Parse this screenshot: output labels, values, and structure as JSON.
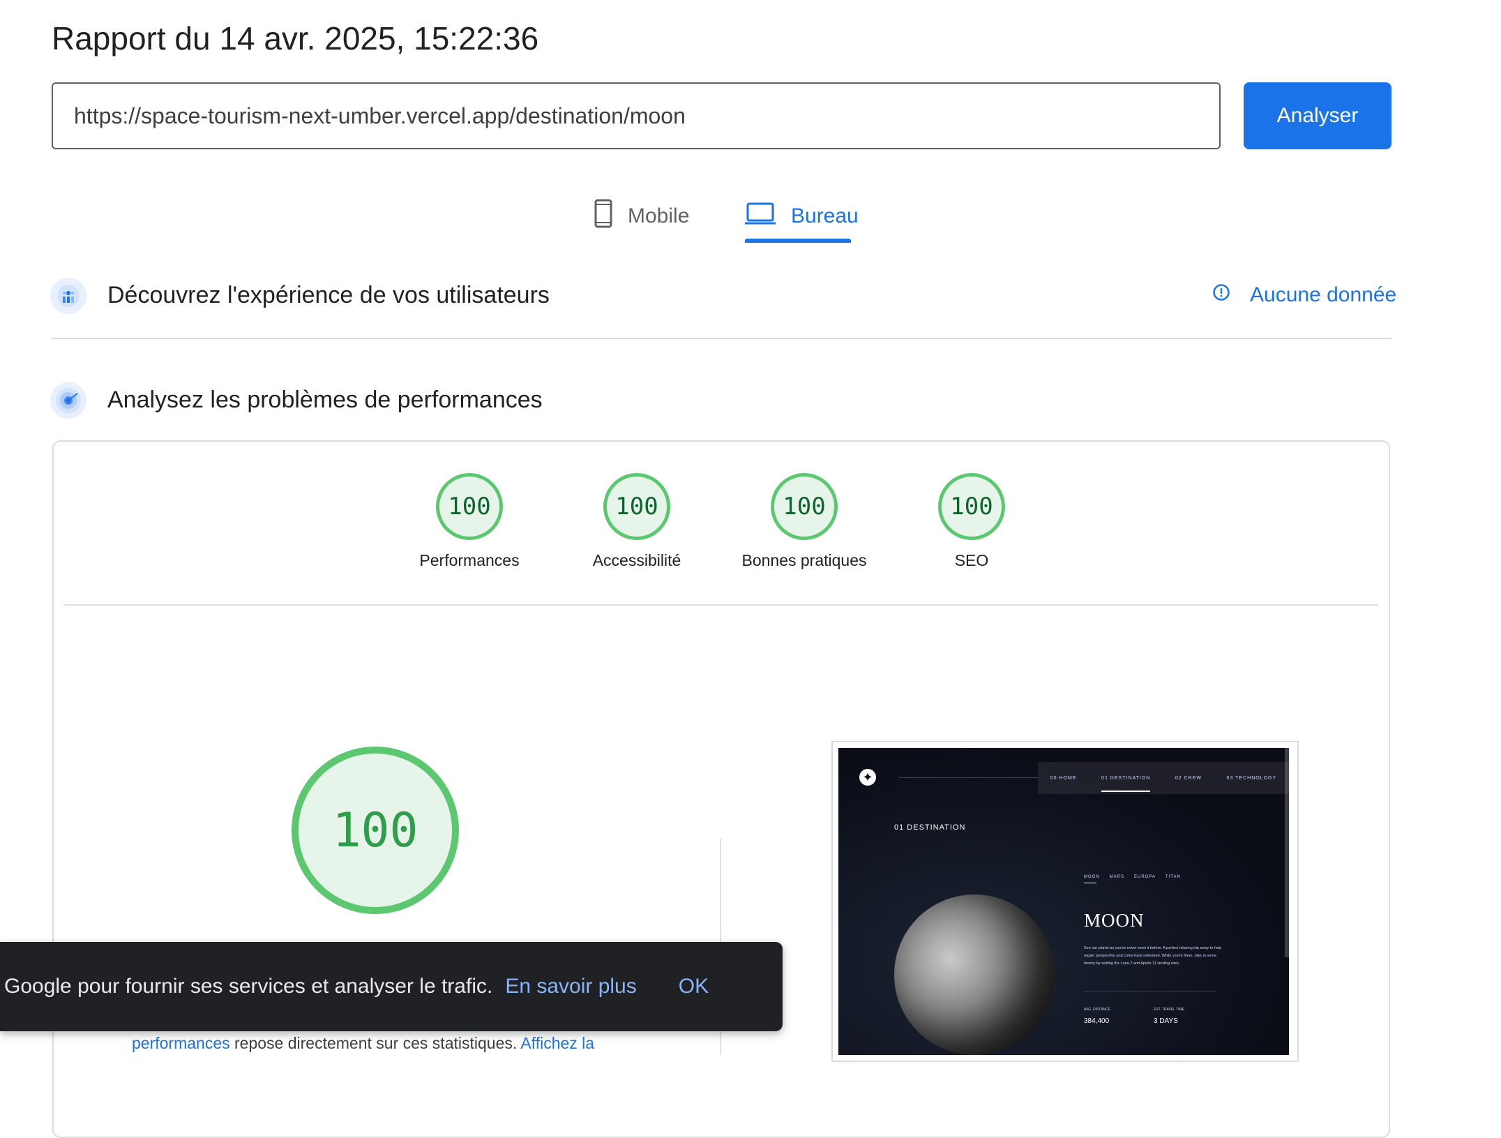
{
  "report": {
    "title": "Rapport du 14 avr. 2025, 15:22:36",
    "url_value": "https://space-tourism-next-umber.vercel.app/destination/moon",
    "analyse_label": "Analyser"
  },
  "tabs": {
    "mobile_label": "Mobile",
    "desktop_label": "Bureau",
    "selected": "Bureau"
  },
  "sections": {
    "users_title": "Découvrez l'expérience de vos utilisateurs",
    "no_data_label": "Aucune donnée",
    "perf_title": "Analysez les problèmes de performances"
  },
  "scores": [
    {
      "value": "100",
      "label": "Performances"
    },
    {
      "value": "100",
      "label": "Accessibilité"
    },
    {
      "value": "100",
      "label": "Bonnes pratiques"
    },
    {
      "value": "100",
      "label": "SEO"
    }
  ],
  "main_score": "100",
  "thumbnail": {
    "nav": [
      "00 HOME",
      "01 DESTINATION",
      "02 CREW",
      "03 TECHNOLOGY"
    ],
    "page_label": "01  DESTINATION",
    "subtabs": [
      "MOON",
      "MARS",
      "EUROPA",
      "TITAN"
    ],
    "heading": "MOON",
    "description": "See our planet as you've never seen it before. A perfect relaxing trip away to help regain perspective and come back refreshed. While you're there, take in some history by visiting the Luna 2 and Apollo 11 landing sites.",
    "stat1_label": "AVG. DISTANCE",
    "stat1_value": "384,400",
    "stat2_label": "EST. TRAVEL TIME",
    "stat2_value": "3 DAYS"
  },
  "bottom": {
    "link1": "performances",
    "text": " repose directement sur ces statistiques. ",
    "link2": "Affichez la"
  },
  "snackbar": {
    "text": "Google pour fournir ses services et analyser le trafic.",
    "learn_more": "En savoir plus",
    "ok": "OK"
  },
  "colors": {
    "accent": "#1a73e8",
    "pass": "#5bc870",
    "pass_bg": "#e6f4ea",
    "snackbar_bg": "#202124"
  }
}
